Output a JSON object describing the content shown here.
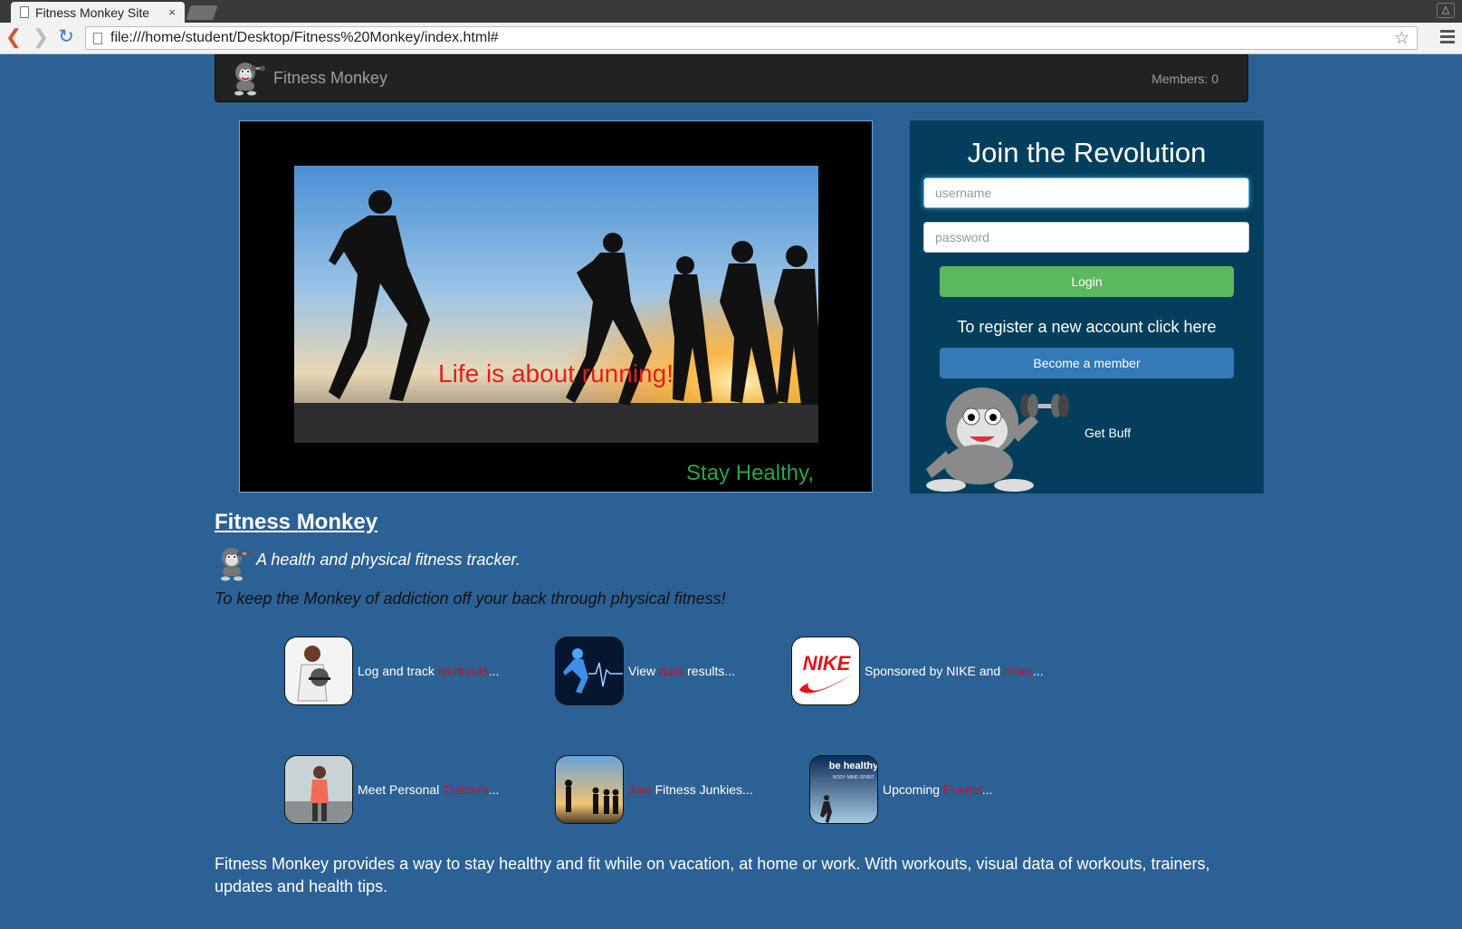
{
  "browser": {
    "tab_title": "Fitness Monkey Site",
    "tab_close": "×",
    "url": "file:///home/student/Desktop/Fitness%20Monkey/index.html#"
  },
  "navbar": {
    "brand": "Fitness Monkey",
    "members": "Members: 0"
  },
  "hero": {
    "caption": "Life is about running!",
    "tagline": "Stay Healthy,"
  },
  "join": {
    "title": "Join the Revolution",
    "username_placeholder": "username",
    "password_placeholder": "password",
    "login_label": "Login",
    "register_text": "To register a new account click here",
    "member_label": "Become a member",
    "get_buff": "Get Buff"
  },
  "about": {
    "title": "Fitness Monkey",
    "subtitle": "A health and physical fitness tracker.",
    "quote": "To keep the Monkey of addiction off your back through physical fitness!"
  },
  "features": [
    {
      "pre": "Log and track ",
      "hl": "workouts",
      "post": "..."
    },
    {
      "pre": "View ",
      "hl": "data",
      "post": " results..."
    },
    {
      "pre": "Sponsored by NIKE and ",
      "hl": "more",
      "post": "..."
    },
    {
      "pre": "Meet Personal ",
      "hl": "Trainers",
      "post": "..."
    },
    {
      "pre": "",
      "hl": "Join",
      "post": " Fitness Junkies..."
    },
    {
      "pre": "Upcoming ",
      "hl": "Events",
      "post": "..."
    }
  ],
  "thumb_text": {
    "nike": "NIKE",
    "healthy_title": "be healthy",
    "healthy_sub": "BODY MIND SPIRIT"
  },
  "footer": {
    "text": "Fitness Monkey provides a way to stay healthy and fit while on vacation, at home or work. With workouts, visual data of workouts, trainers, updates and health tips."
  },
  "colors": {
    "page_bg": "#2c6195",
    "navbar_bg": "#222222",
    "join_bg": "#033f5c",
    "login_green": "#5cb85c",
    "member_blue": "#337ab7",
    "highlight_red": "#c8102e",
    "caption_red": "#e02020",
    "tagline_green": "#28a745"
  }
}
